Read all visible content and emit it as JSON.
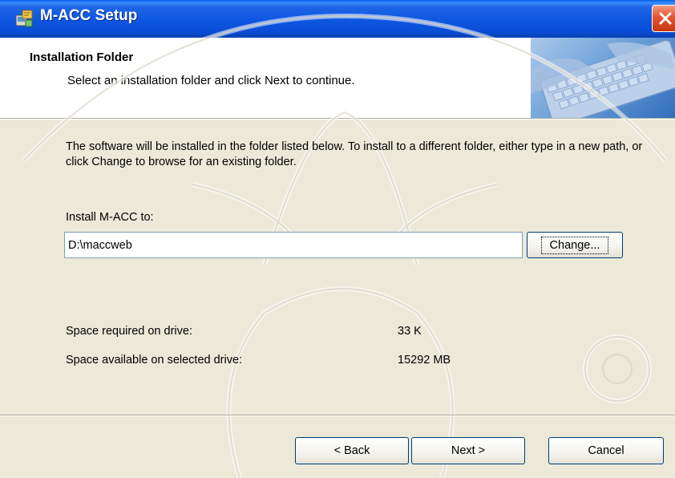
{
  "window": {
    "title": "M-ACC Setup",
    "icon": "installer-icon",
    "close_icon": "close-icon"
  },
  "header": {
    "title": "Installation Folder",
    "subtitle": "Select an installation folder and click Next to continue."
  },
  "main": {
    "description": "The software will be installed in the folder listed below. To install to a different folder, either type in a new path, or click Change to browse for an existing folder.",
    "install_label": "Install M-ACC to:",
    "install_path": "D:\\maccweb",
    "change_label": "Change...",
    "space_required_label": "Space required on drive:",
    "space_required_value": "33 K",
    "space_available_label": "Space available on selected drive:",
    "space_available_value": "15292 MB"
  },
  "footer": {
    "back_label": "< Back",
    "next_label": "Next >",
    "cancel_label": "Cancel"
  },
  "colors": {
    "titlebar": "#0D56E0",
    "dialog_bg": "#ECE9D8",
    "close": "#E5532F",
    "button_border": "#003C74"
  }
}
